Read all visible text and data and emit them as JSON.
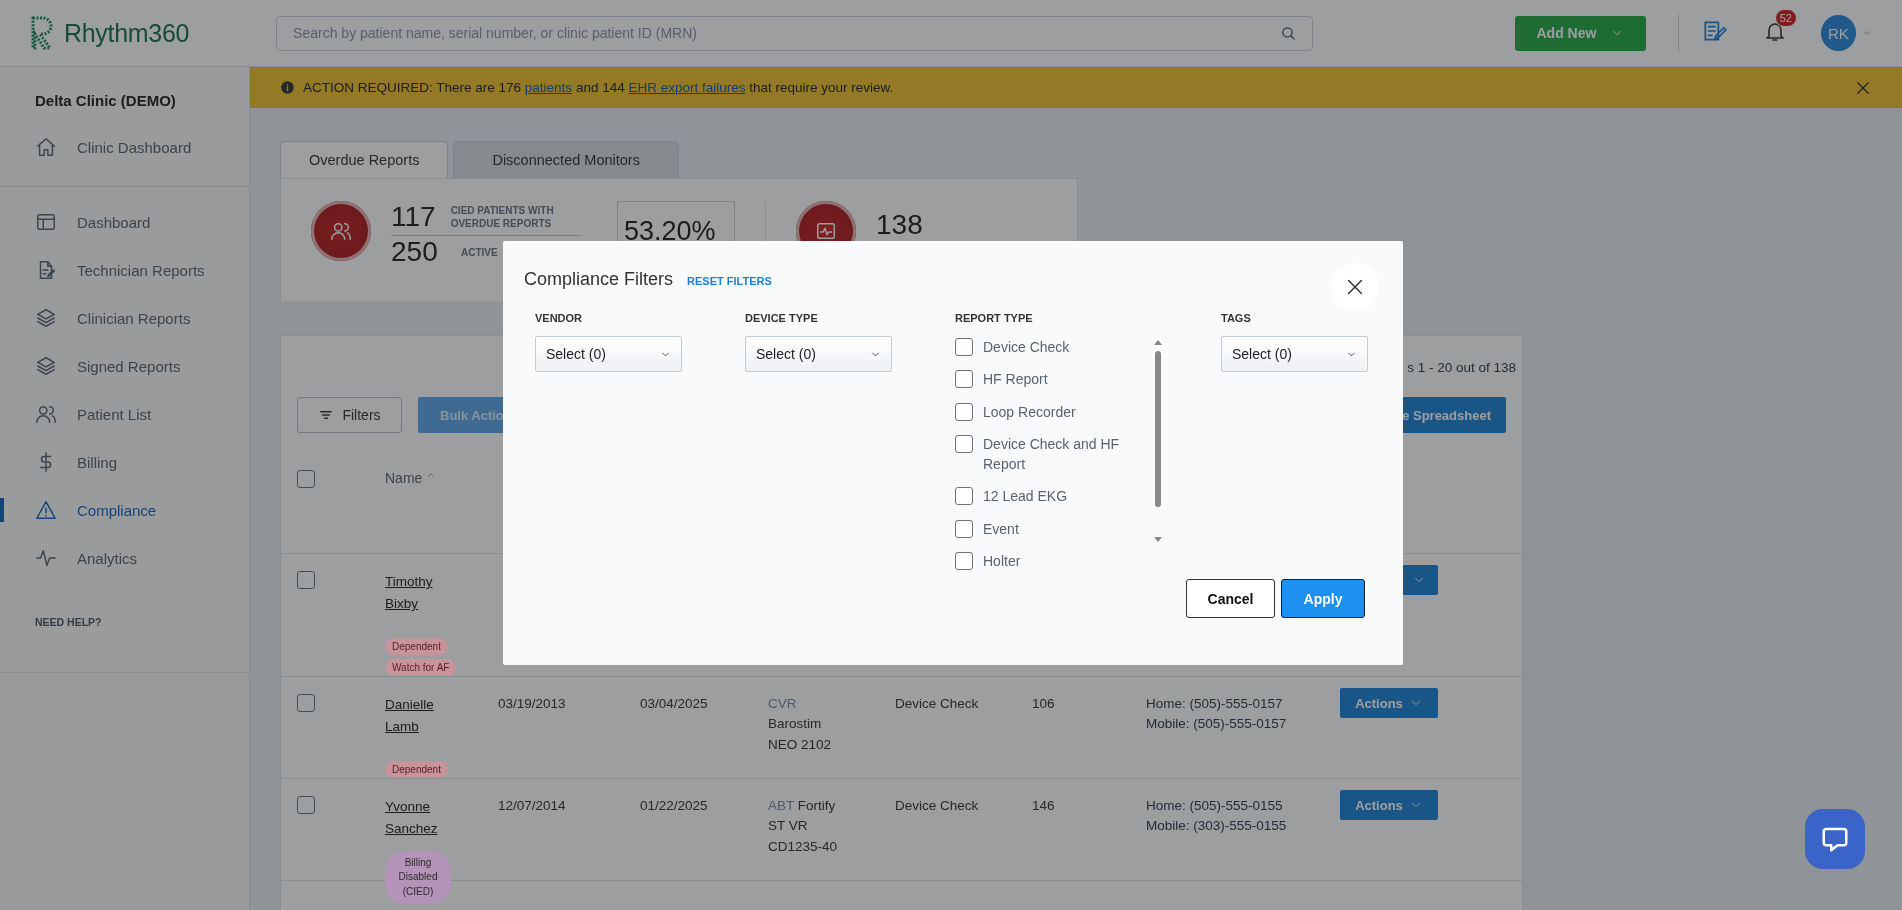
{
  "header": {
    "brand": "Rhythm360",
    "search": {
      "placeholder": "Search by patient name, serial number, or clinic patient ID (MRN)"
    },
    "add_button": "Add New",
    "notification_count": "52",
    "user_initials": "RK"
  },
  "banner": {
    "segments": [
      {
        "text": "ACTION REQUIRED: There are 176 "
      },
      {
        "text": "patients",
        "kind": "link"
      },
      {
        "text": " and 144 "
      },
      {
        "text": "EHR export failures",
        "kind": "link"
      },
      {
        "text": " that require your review."
      }
    ]
  },
  "sidebar": {
    "clinic": "Delta Clinic (DEMO)",
    "top_items": [
      {
        "label": "Clinic Dashboard",
        "selected": false
      }
    ],
    "items": [
      {
        "label": "Dashboard",
        "selected": false
      },
      {
        "label": "Technician Reports",
        "selected": false
      },
      {
        "label": "Clinician Reports",
        "selected": false
      },
      {
        "label": "Signed Reports",
        "selected": false
      },
      {
        "label": "Patient List",
        "selected": false
      },
      {
        "label": "Billing",
        "selected": false
      },
      {
        "label": "Compliance",
        "selected": true
      },
      {
        "label": "Analytics",
        "selected": false
      }
    ],
    "help": "NEED HELP?"
  },
  "tabs": [
    {
      "label": "Overdue Reports",
      "selected": true
    },
    {
      "label": "Disconnected Monitors",
      "selected": false
    }
  ],
  "stats": {
    "overdue_count": "117",
    "overdue_label": "CIED PATIENTS WITH OVERDUE REPORTS",
    "active_count": "250",
    "active_label": "ACTIVE",
    "percent": "53.20%",
    "monitors_count": "138"
  },
  "table": {
    "paging": "s 1 - 20 out of 138",
    "filters_button": "Filters",
    "bulk_button": "Bulk Actio",
    "export_button": "e Spreadsheet",
    "name_column": "Name",
    "header_checked": false,
    "rows": [
      {
        "name": "Timothy Bixby",
        "checked": false,
        "tags": [
          {
            "label": "Dependent",
            "color": "#c8949b"
          },
          {
            "label": "Watch for AF",
            "color": "#c8949b"
          }
        ]
      },
      {
        "name": "Danielle Lamb",
        "checked": false,
        "birth_date": "03/19/2013",
        "last_date": "03/04/2025",
        "vendor": "CVR",
        "device": "Barostim NEO 2102",
        "report_type": "Device Check",
        "days": "106",
        "phones": [
          "Home: (505)-555-0157",
          "Mobile: (505)-555-0157"
        ],
        "actions": "Actions",
        "tags": [
          {
            "label": "Dependent",
            "color": "#c8949b"
          }
        ]
      },
      {
        "name": "Yvonne Sanchez",
        "checked": false,
        "birth_date": "12/07/2014",
        "last_date": "01/22/2025",
        "vendor": "ABT",
        "device": "Fortify ST VR CD1235-40",
        "report_type": "Device Check",
        "days": "146",
        "phones": [
          "Home: (505)-555-0155",
          "Mobile: (303)-555-0155"
        ],
        "actions": "Actions",
        "tags": [
          {
            "label": "Billing Disabled (CIED)",
            "color": "#b493b8"
          }
        ]
      }
    ]
  },
  "modal": {
    "title": "Compliance Filters",
    "reset": "RESET FILTERS",
    "vendor": {
      "label": "VENDOR",
      "value": "Select (0)"
    },
    "device_type": {
      "label": "DEVICE TYPE",
      "value": "Select (0)"
    },
    "report_type": {
      "label": "REPORT TYPE",
      "options": [
        {
          "label": "Device Check",
          "checked": false
        },
        {
          "label": "HF Report",
          "checked": false
        },
        {
          "label": "Loop Recorder",
          "checked": false
        },
        {
          "label": "Device Check and HF Report",
          "checked": false
        },
        {
          "label": "12 Lead EKG",
          "checked": false
        },
        {
          "label": "Event",
          "checked": false
        },
        {
          "label": "Holter",
          "checked": false
        }
      ]
    },
    "tags": {
      "label": "TAGS",
      "value": "Select (0)"
    },
    "cancel": "Cancel",
    "apply": "Apply"
  }
}
